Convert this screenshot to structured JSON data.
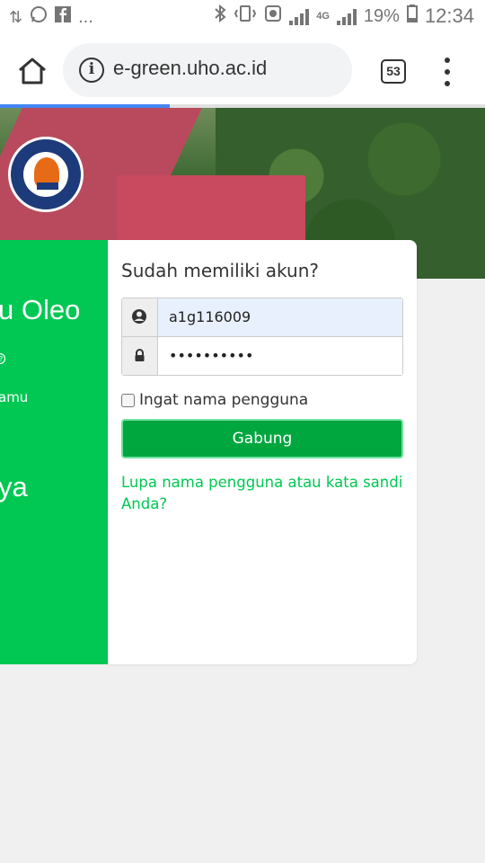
{
  "status_bar": {
    "left_icons": [
      "usb-icon",
      "whatsapp-icon",
      "facebook-icon"
    ],
    "more": "...",
    "right_icons": [
      "bluetooth-icon",
      "vibrate-icon",
      "data-saver-icon",
      "signal-icon",
      "4g-icon",
      "signal-icon"
    ],
    "network_type": "4G",
    "battery": "19%",
    "time": "12:34"
  },
  "browser": {
    "url": "e-green.uho.ac.id",
    "tab_count": "53",
    "load_progress": 0.35
  },
  "left_panel": {
    "title_fragment": "u Oleo",
    "small_text_fragment": "amu",
    "large_text_fragment": "ya"
  },
  "login": {
    "heading": "Sudah memiliki akun?",
    "username_value": "a1g116009",
    "password_value": "••••••••••",
    "remember_label": "Ingat nama pengguna",
    "remember_checked": false,
    "submit_label": "Gabung",
    "forgot_link": "Lupa nama pengguna atau kata sandi Anda?"
  },
  "colors": {
    "accent_green": "#00c853",
    "button_green": "#00a63e",
    "progress_blue": "#4285f4"
  }
}
